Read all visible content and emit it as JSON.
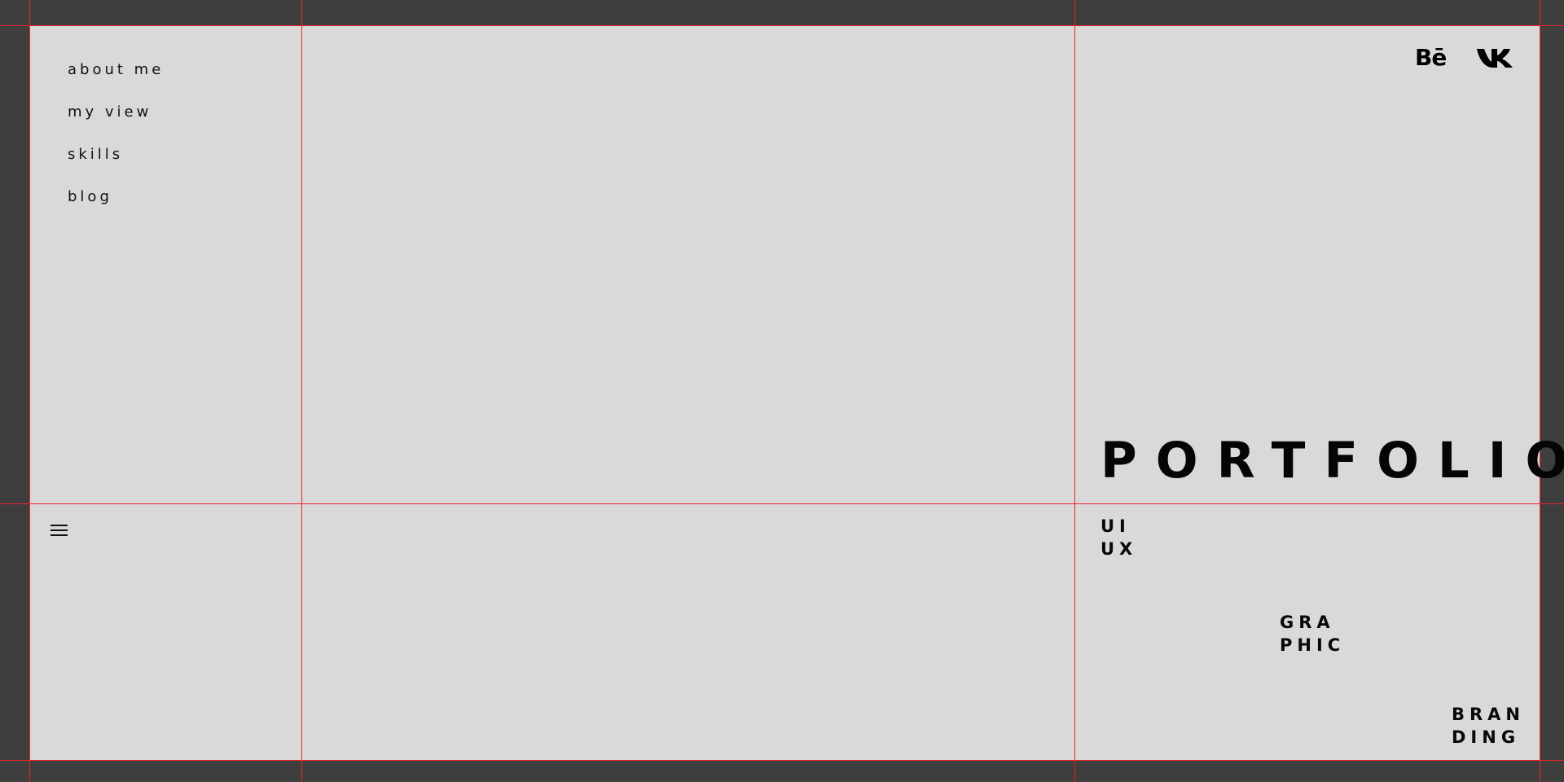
{
  "nav": {
    "items": [
      {
        "label": "about me"
      },
      {
        "label": "my view"
      },
      {
        "label": "skills"
      },
      {
        "label": "blog"
      }
    ]
  },
  "social": {
    "behance": {
      "label": "Bē",
      "icon": "behance-icon"
    },
    "vk": {
      "icon": "vk-icon"
    }
  },
  "hero": {
    "title": "PORTFOLIO"
  },
  "menu": {
    "icon": "hamburger-menu-icon"
  },
  "categories": [
    {
      "line1": "UI",
      "line2": "UX"
    },
    {
      "line1": "GRA",
      "line2": "PHIC"
    },
    {
      "line1": "BRAN",
      "line2": "DING"
    }
  ],
  "colors": {
    "frame": "#3e3e3e",
    "canvas": "#d9d9d9",
    "guides": "#e8242a",
    "text": "#000000"
  }
}
